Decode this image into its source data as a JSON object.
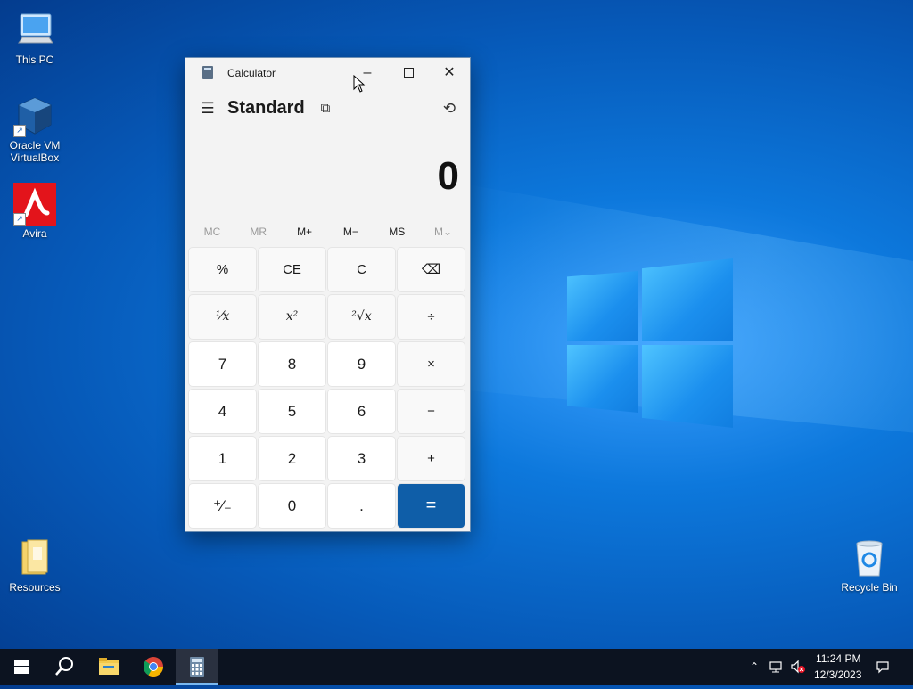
{
  "desktop": {
    "icons": [
      {
        "label_line1": "This PC",
        "label_line2": ""
      },
      {
        "label_line1": "Oracle VM",
        "label_line2": "VirtualBox"
      },
      {
        "label_line1": "Avira",
        "label_line2": ""
      },
      {
        "label_line1": "Resources",
        "label_line2": ""
      },
      {
        "label_line1": "Recycle Bin",
        "label_line2": ""
      }
    ]
  },
  "calculator": {
    "window_title": "Calculator",
    "mode": "Standard",
    "display_value": "0",
    "memory_buttons": [
      "MC",
      "MR",
      "M+",
      "M−",
      "MS",
      "M⌄"
    ],
    "keys": [
      "%",
      "CE",
      "C",
      "⌫",
      "¹⁄x",
      "x²",
      "²√x",
      "÷",
      "7",
      "8",
      "9",
      "×",
      "4",
      "5",
      "6",
      "−",
      "1",
      "2",
      "3",
      "+",
      "⁺⁄₋",
      "0",
      ".",
      "="
    ],
    "accent_color": "#0f5ea8"
  },
  "taskbar": {
    "clock_time": "11:24 PM",
    "clock_date": "12/3/2023"
  }
}
